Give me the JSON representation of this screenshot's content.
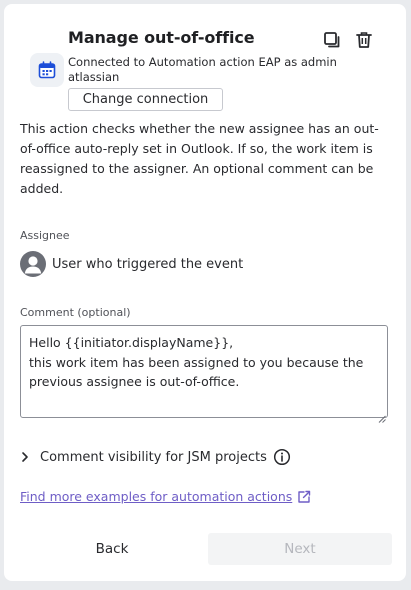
{
  "header": {
    "title": "Manage out-of-office",
    "app_icon": "calendar-icon",
    "duplicate_icon": "duplicate-icon",
    "delete_icon": "trash-icon"
  },
  "connection": {
    "text": "Connected to Automation action EAP as admin atlassian",
    "change_label": "Change connection"
  },
  "description": "This action checks whether the new assignee has an out-of-office auto-reply set in Outlook. If so, the work item is reassigned to the assigner. An optional comment can be added.",
  "assignee": {
    "label": "Assignee",
    "value": "User who triggered the event",
    "icon": "user-avatar-icon"
  },
  "comment": {
    "label": "Comment (optional)",
    "value": "Hello {{initiator.displayName}},\nthis work item has been assigned to you because the previous assignee is out-of-office."
  },
  "visibility": {
    "label": "Comment visibility for JSM projects",
    "icon": "info-icon"
  },
  "examples_link": "Find more examples for automation actions",
  "footer": {
    "back_label": "Back",
    "next_label": "Next"
  },
  "colors": {
    "accent": "#6e5dc6",
    "calendar": "#1d4ed8",
    "disabled_text": "#b5b7bd"
  }
}
